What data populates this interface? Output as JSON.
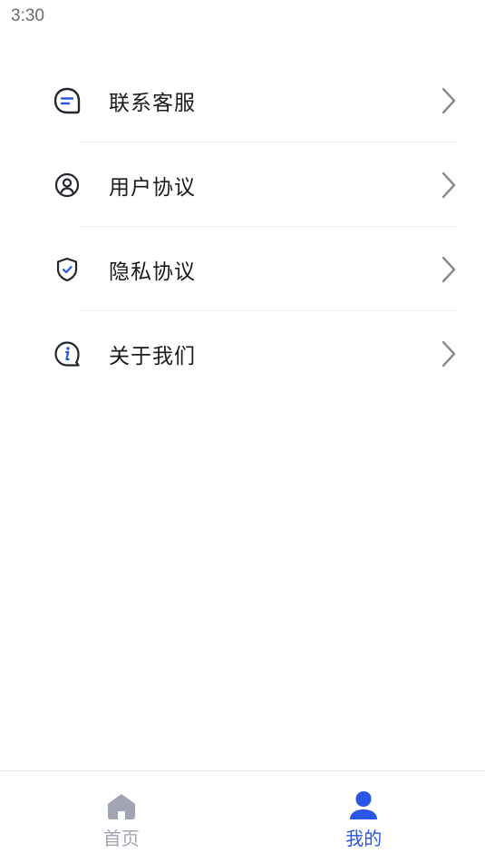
{
  "status_bar": {
    "time": "3:30"
  },
  "menu": {
    "items": [
      {
        "label": "联系客服",
        "icon": "message-icon"
      },
      {
        "label": "用户协议",
        "icon": "user-circle-icon"
      },
      {
        "label": "隐私协议",
        "icon": "shield-check-icon"
      },
      {
        "label": "关于我们",
        "icon": "info-icon"
      }
    ]
  },
  "tab_bar": {
    "tabs": [
      {
        "label": "首页",
        "icon": "home-icon",
        "active": false,
        "color": "#a1a4b2"
      },
      {
        "label": "我的",
        "icon": "user-icon",
        "active": true,
        "color": "#2a55e5"
      }
    ]
  },
  "colors": {
    "accent": "#2a55e5",
    "icon_dark": "#23262e",
    "inactive": "#a1a4b2",
    "chevron": "#8a8a8a"
  }
}
